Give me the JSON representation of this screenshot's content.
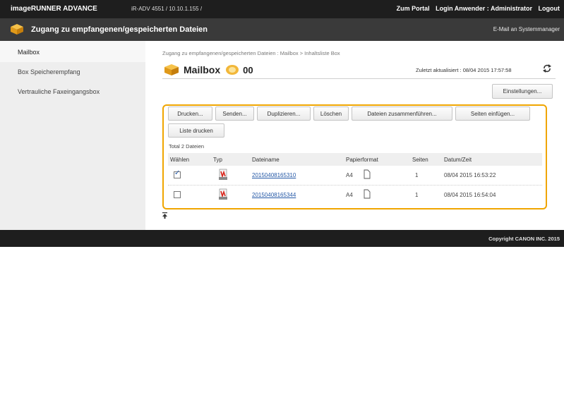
{
  "header": {
    "brand": "imageRUNNER ADVANCE",
    "device_info": "iR-ADV 4551 / 10.10.1.155 /",
    "portal_link": "Zum Portal",
    "login_user": "Login Anwender :  Administrator",
    "logout": "Logout"
  },
  "titlebar": {
    "title": "Zugang zu empfangenen/gespeicherten Dateien",
    "mail_manager": "E-Mail an Systemmanager"
  },
  "sidebar": {
    "items": [
      {
        "label": "Mailbox",
        "active": true
      },
      {
        "label": "Box Speicherempfang"
      },
      {
        "label": "Vertrauliche Faxeingangsbox"
      }
    ]
  },
  "main": {
    "breadcrumb": "Zugang zu empfangenen/gespeicherten Dateien : Mailbox > Inhaltsliste Box",
    "heading": "Mailbox",
    "box_number": "00",
    "last_updated": "Zuletzt aktualisiert : 08/04 2015 17:57:58",
    "settings_button": "Einstellungen..."
  },
  "actions": {
    "print": "Drucken...",
    "send": "Senden...",
    "duplicate": "Duplizieren...",
    "delete": "Löschen",
    "merge": "Dateien zusammenführen...",
    "insert_pages": "Seiten einfügen...",
    "print_list": "Liste drucken"
  },
  "table": {
    "total": "Total 2 Dateien",
    "columns": [
      "Wählen",
      "Typ",
      "Dateiname",
      "Papierformat",
      "Seiten",
      "Datum/Zeit"
    ],
    "rows": [
      {
        "selected": true,
        "filename": "20150408165310",
        "paper": "A4",
        "pages": "1",
        "datetime": "08/04 2015 16:53:22"
      },
      {
        "selected": false,
        "filename": "20150408165344",
        "paper": "A4",
        "pages": "1",
        "datetime": "08/04 2015 16:54:04"
      }
    ]
  },
  "footer": {
    "copyright": "Copyright CANON INC. 2015"
  },
  "colors": {
    "highlight_border": "#f0a500",
    "link": "#2458a6",
    "bar_dark": "#1e1e1e"
  }
}
